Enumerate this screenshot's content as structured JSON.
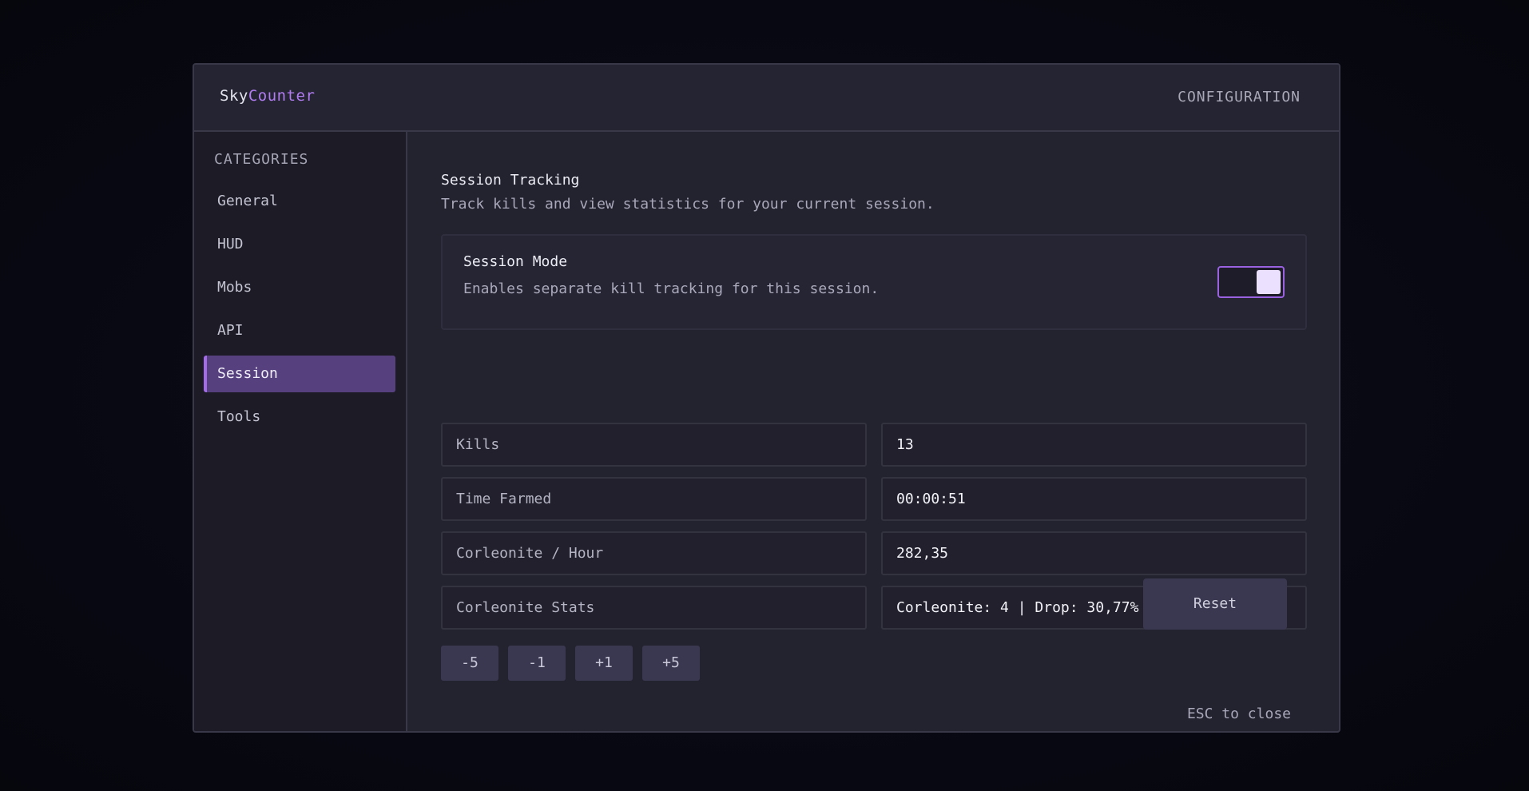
{
  "header": {
    "brand_part1": "Sky",
    "brand_part2": "Counter",
    "title": "CONFIGURATION"
  },
  "sidebar": {
    "heading": "CATEGORIES",
    "items": [
      {
        "label": "General",
        "active": false
      },
      {
        "label": "HUD",
        "active": false
      },
      {
        "label": "Mobs",
        "active": false
      },
      {
        "label": "API",
        "active": false
      },
      {
        "label": "Session",
        "active": true
      },
      {
        "label": "Tools",
        "active": false
      }
    ]
  },
  "section": {
    "title": "Session Tracking",
    "description": "Track kills and view statistics for your current session."
  },
  "session_mode": {
    "title": "Session Mode",
    "description": "Enables separate kill tracking for this session.",
    "enabled": true
  },
  "stats": [
    {
      "label": "Kills",
      "value": "13"
    },
    {
      "label": "Time Farmed",
      "value": "00:00:51"
    },
    {
      "label": "Corleonite / Hour",
      "value": "282,35"
    },
    {
      "label": "Corleonite Stats",
      "value": "Corleonite: 4 | Drop: 30,77%"
    }
  ],
  "buttons": {
    "minus5": "-5",
    "minus1": "-1",
    "plus1": "+1",
    "plus5": "+5",
    "reset": "Reset"
  },
  "footer": {
    "esc_hint": "ESC to close"
  },
  "colors": {
    "accent": "#a46ce8",
    "accent_bg": "#57407e",
    "brand_highlight": "#b07cf0"
  }
}
